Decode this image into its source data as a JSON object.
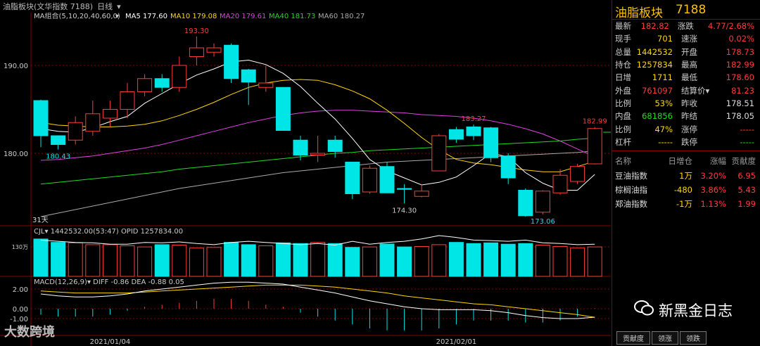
{
  "header": {
    "instrument": "油脂板块(文华指数 7188)",
    "period": "日线",
    "ma_label": "MA组合(5,10,20,40,60,0)",
    "ma": [
      {
        "label": "MA5",
        "value": "177.60",
        "color": "#ffffff"
      },
      {
        "label": "MA10",
        "value": "179.08",
        "color": "#ffd700"
      },
      {
        "label": "MA20",
        "value": "179.61",
        "color": "#e040e0"
      },
      {
        "label": "MA40",
        "value": "181.73",
        "color": "#1edc1e"
      },
      {
        "label": "MA60",
        "value": "180.27",
        "color": "#aaaaaa"
      }
    ]
  },
  "colors": {
    "up": "#ff3b3b",
    "down": "#00e5e5",
    "ma5": "#ffffff",
    "ma10": "#ffd700",
    "ma20": "#e040e0",
    "ma40": "#1edc1e",
    "ma60": "#aaaaaa"
  },
  "chart_data": {
    "type": "candlestick",
    "ylim": [
      172,
      196
    ],
    "y_ticks": [
      "190.00",
      "180.00"
    ],
    "x_ticks": [
      "2021/01/04",
      "2021/02/01"
    ],
    "candles": [
      [
        186,
        182,
        186.1,
        180.7,
        "d"
      ],
      [
        182,
        181,
        182,
        180.43,
        "d"
      ],
      [
        181.5,
        183.5,
        184.2,
        181,
        "u"
      ],
      [
        182.5,
        184.5,
        186,
        182,
        "u"
      ],
      [
        184,
        185,
        186,
        183,
        "u"
      ],
      [
        185,
        187,
        188,
        184,
        "u"
      ],
      [
        187,
        188.5,
        189,
        186.5,
        "u"
      ],
      [
        188.5,
        187.5,
        189,
        187,
        "d"
      ],
      [
        187.5,
        190,
        191,
        187,
        "u"
      ],
      [
        191,
        192,
        193.3,
        190,
        "u"
      ],
      [
        191.5,
        192,
        192.5,
        191,
        "u"
      ],
      [
        192.3,
        188.5,
        192.5,
        188,
        "d"
      ],
      [
        189.5,
        188.1,
        189.6,
        185.5,
        "d"
      ],
      [
        187.5,
        188,
        190,
        187,
        "u"
      ],
      [
        187.5,
        182.6,
        187.5,
        182.6,
        "d"
      ],
      [
        181.5,
        179.8,
        182,
        179.2,
        "d"
      ],
      [
        179.8,
        180,
        182,
        179,
        "u"
      ],
      [
        181.5,
        180.2,
        182,
        179.5,
        "d"
      ],
      [
        179,
        175.4,
        179,
        174.8,
        "d"
      ],
      [
        175.6,
        178.3,
        178.6,
        175.4,
        "u"
      ],
      [
        178.5,
        175.5,
        179,
        175.5,
        "d"
      ],
      [
        176,
        175.9,
        176.5,
        174.3,
        "d"
      ],
      [
        175.1,
        175.7,
        176.5,
        175,
        "u"
      ],
      [
        178,
        182,
        182.2,
        178,
        "u"
      ],
      [
        182.7,
        181.6,
        183,
        181.2,
        "d"
      ],
      [
        183,
        182,
        183.27,
        181.5,
        "d"
      ],
      [
        182.9,
        179.5,
        183,
        179,
        "d"
      ],
      [
        179.7,
        177.2,
        180,
        176.5,
        "d"
      ],
      [
        175.8,
        172.9,
        176,
        172.8,
        "d"
      ],
      [
        173.3,
        175.7,
        175.8,
        173.06,
        "u"
      ],
      [
        175.5,
        177.5,
        178.2,
        175.3,
        "u"
      ],
      [
        176.8,
        178.5,
        178.8,
        176.5,
        "u"
      ],
      [
        178.8,
        182.82,
        182.99,
        178.73,
        "u"
      ]
    ],
    "annotations": [
      {
        "text": "193.30",
        "i": 9,
        "y": 193.3,
        "color": "#ff3b3b",
        "pos": "above"
      },
      {
        "text": "180.43",
        "i": 1,
        "y": 180.43,
        "color": "#00e5e5",
        "pos": "below"
      },
      {
        "text": "174.30",
        "i": 21,
        "y": 174.3,
        "color": "#cccccc",
        "pos": "below"
      },
      {
        "text": "183.27",
        "i": 25,
        "y": 183.27,
        "color": "#ff3b3b",
        "pos": "above"
      },
      {
        "text": "173.06",
        "i": 29,
        "y": 173.06,
        "color": "#00e5e5",
        "pos": "below"
      },
      {
        "text": "182.99",
        "i": 32,
        "y": 182.99,
        "color": "#ff3b3b",
        "pos": "above"
      }
    ],
    "ma5": [
      182.8,
      182.5,
      182.4,
      182.9,
      183.6,
      184.2,
      185.7,
      186.8,
      187.9,
      188.9,
      189.6,
      190.4,
      190.6,
      190.1,
      189.1,
      187.6,
      185.7,
      183.9,
      181.7,
      179.3,
      178.0,
      177.2,
      176.4,
      176.7,
      177.3,
      178.6,
      180.0,
      179.6,
      177.8,
      176.6,
      175.8,
      175.8,
      177.6
    ],
    "ma10": [
      183.5,
      183.2,
      183.1,
      183.0,
      183.0,
      183.1,
      183.3,
      183.7,
      184.3,
      185.0,
      185.8,
      186.7,
      187.5,
      188.0,
      188.3,
      188.4,
      188.3,
      187.8,
      187.1,
      186.2,
      184.9,
      183.4,
      181.8,
      180.4,
      179.3,
      178.9,
      178.7,
      178.4,
      178.1,
      177.9,
      177.9,
      178.5,
      179.1
    ],
    "ma20": [
      179.2,
      179.3,
      179.5,
      179.7,
      180.0,
      180.3,
      180.6,
      181.0,
      181.5,
      182.0,
      182.5,
      183.0,
      183.5,
      183.9,
      184.3,
      184.6,
      184.8,
      184.9,
      184.9,
      184.8,
      184.7,
      184.6,
      184.4,
      184.3,
      184.2,
      184.0,
      183.7,
      183.3,
      182.8,
      182.2,
      181.4,
      180.5,
      179.6
    ],
    "ma40": [
      176.5,
      176.7,
      176.9,
      177.1,
      177.3,
      177.5,
      177.7,
      177.9,
      178.2,
      178.4,
      178.6,
      178.8,
      179.0,
      179.2,
      179.4,
      179.6,
      179.8,
      180.0,
      180.1,
      180.3,
      180.4,
      180.5,
      180.6,
      180.7,
      180.8,
      180.9,
      181.0,
      181.1,
      181.2,
      181.3,
      181.4,
      181.6,
      181.73
    ],
    "ma60": [
      172.8,
      173.2,
      173.6,
      174.0,
      174.4,
      174.8,
      175.2,
      175.6,
      176.0,
      176.3,
      176.6,
      176.9,
      177.2,
      177.5,
      177.8,
      178.0,
      178.2,
      178.4,
      178.6,
      178.8,
      179.0,
      179.1,
      179.2,
      179.3,
      179.4,
      179.5,
      179.6,
      179.7,
      179.8,
      179.9,
      180.0,
      180.1,
      180.27
    ],
    "volume": {
      "label": "CJL",
      "volume": "1442532.00(53:47)",
      "opid_label": "OPID",
      "opid": "1257834.00",
      "tick": "130万",
      "values": [
        1.65,
        1.5,
        1.48,
        1.4,
        1.4,
        1.35,
        1.3,
        1.4,
        1.38,
        1.25,
        1.28,
        1.5,
        1.4,
        1.35,
        1.48,
        1.45,
        1.5,
        1.45,
        1.28,
        1.3,
        1.43,
        1.3,
        1.32,
        1.4,
        1.5,
        1.45,
        1.48,
        1.42,
        1.45,
        1.38,
        1.32,
        1.25,
        1.3
      ],
      "opid_line": [
        1.6,
        1.55,
        1.5,
        1.48,
        1.42,
        1.42,
        1.5,
        1.48,
        1.52,
        1.45,
        1.4,
        1.5,
        1.55,
        1.5,
        1.45,
        1.4,
        1.45,
        1.38,
        1.55,
        1.42,
        1.5,
        1.55,
        1.65,
        1.8,
        1.72,
        1.6,
        1.58,
        1.55,
        1.6,
        1.48,
        1.45,
        1.4,
        1.42
      ]
    },
    "macd": {
      "label": "MACD(12,26,9)",
      "diff_label": "DIFF",
      "diff": "-0.86",
      "dea_label": "DEA",
      "dea": "-0.88",
      "hist_label": "0.05",
      "ticks": [
        "2.00",
        "0.00",
        "-1.00"
      ],
      "diff_line": [
        1.5,
        1.3,
        1.2,
        1.2,
        1.3,
        1.5,
        1.8,
        2.0,
        2.2,
        2.4,
        2.6,
        2.7,
        2.7,
        2.6,
        2.5,
        2.2,
        1.9,
        1.6,
        1.2,
        0.8,
        0.5,
        0.2,
        0.0,
        -0.1,
        -0.1,
        -0.1,
        -0.2,
        -0.4,
        -0.7,
        -0.9,
        -1.0,
        -1.0,
        -0.86
      ],
      "dea_line": [
        1.8,
        1.7,
        1.6,
        1.6,
        1.6,
        1.6,
        1.7,
        1.8,
        1.9,
        2.0,
        2.1,
        2.2,
        2.3,
        2.4,
        2.4,
        2.4,
        2.3,
        2.2,
        2.0,
        1.8,
        1.6,
        1.3,
        1.1,
        0.9,
        0.7,
        0.5,
        0.4,
        0.2,
        0.0,
        -0.2,
        -0.4,
        -0.6,
        -0.88
      ],
      "hist": [
        -0.6,
        -0.8,
        -0.8,
        -0.8,
        -0.6,
        -0.2,
        0.2,
        0.4,
        0.6,
        0.8,
        1.0,
        1.0,
        0.8,
        0.4,
        0.2,
        -0.4,
        -0.8,
        -1.2,
        -1.6,
        -2.0,
        -2.2,
        -2.2,
        -2.2,
        -2.0,
        -1.6,
        -1.2,
        -1.2,
        -1.2,
        -1.4,
        -1.4,
        -1.2,
        -0.8,
        0.05
      ]
    },
    "days_label": "31天"
  },
  "panel": {
    "title": "油脂板块",
    "code": "7188",
    "quotes": [
      [
        "最新",
        "182.82",
        "red",
        "涨跌",
        "4.77/2.68%",
        "red"
      ],
      [
        "现手",
        "701",
        "yel",
        "速涨",
        "0.02%",
        "red"
      ],
      [
        "总量",
        "1442532",
        "yel",
        "开盘",
        "178.73",
        "red"
      ],
      [
        "持仓",
        "1257834",
        "yel",
        "最高",
        "182.99",
        "red"
      ],
      [
        "日增",
        "1711",
        "yel",
        "最低",
        "178.60",
        "red"
      ],
      [
        "外盘",
        "761097",
        "red",
        "结算价",
        "81.23",
        "red"
      ],
      [
        "比例",
        "53%",
        "yel",
        "昨收",
        "178.51",
        "wht"
      ],
      [
        "内盘",
        "681856",
        "grn",
        "昨结",
        "178.05",
        "wht"
      ],
      [
        "比例",
        "47%",
        "yel",
        "涨停",
        "-----",
        "red"
      ],
      [
        "杠杆",
        "-----",
        "yel",
        "跌停",
        "-----",
        "grn"
      ]
    ],
    "sector_header": [
      "名称",
      "日增仓",
      "涨幅",
      "贡献度"
    ],
    "sectors": [
      [
        "豆油指数",
        "1万",
        "3.20%",
        "6.95"
      ],
      [
        "棕榈油指",
        "-480",
        "3.86%",
        "5.43"
      ],
      [
        "郑油指数",
        "-1万",
        "1.13%",
        "1.99"
      ]
    ],
    "tabs": [
      "贡献度",
      "领涨",
      "领跌"
    ]
  },
  "watermarks": {
    "wechat": "新黑金日志",
    "logo": "大数跨境"
  }
}
